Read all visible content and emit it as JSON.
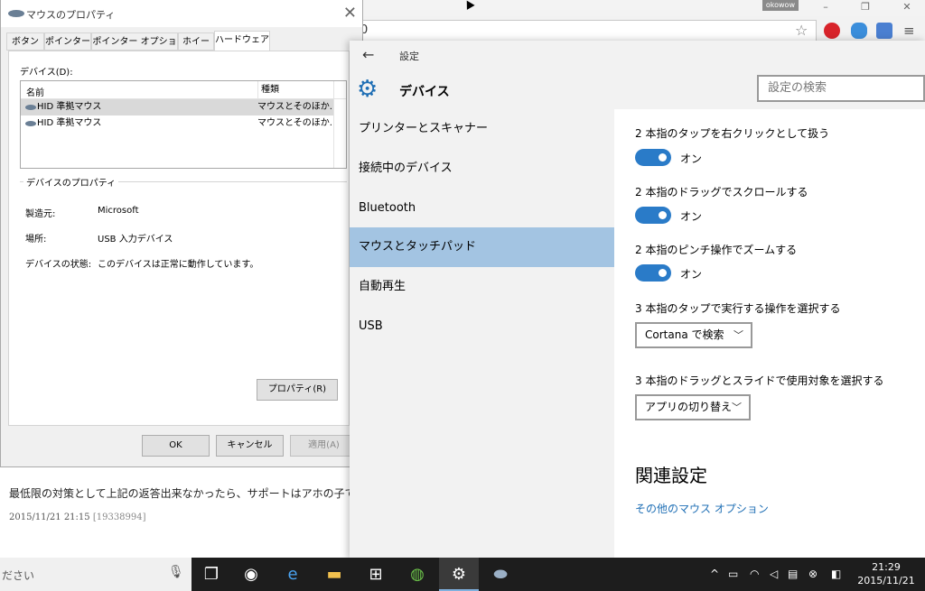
{
  "browser": {
    "user_chip": "okowow",
    "omnibox_text": "0"
  },
  "forum": {
    "body": "最低限の対策として上記の返答出来なかったら、サポートはアホの子ですね",
    "date": "2015/11/21 21:15",
    "post_id": "[19338994]"
  },
  "mouse_dialog": {
    "title": "マウスのプロパティ",
    "tabs": [
      "ボタン",
      "ポインター",
      "ポインター オプション",
      "ホイール",
      "ハードウェア"
    ],
    "active_tab": "ハードウェア",
    "devices_label": "デバイス(D):",
    "columns": [
      "名前",
      "種類"
    ],
    "devices": [
      {
        "name": "HID 準拠マウス",
        "kind": "マウスとそのほか..."
      },
      {
        "name": "HID 準拠マウス",
        "kind": "マウスとそのほか..."
      }
    ],
    "properties_legend": "デバイスのプロパティ",
    "properties": [
      {
        "key": "製造元:",
        "value": "Microsoft"
      },
      {
        "key": "場所:",
        "value": "USB 入力デバイス"
      },
      {
        "key": "デバイスの状態:",
        "value": "このデバイスは正常に動作しています。"
      }
    ],
    "properties_button": "プロパティ(R)",
    "ok": "OK",
    "cancel": "キャンセル",
    "apply": "適用(A)"
  },
  "settings": {
    "app_title": "設定",
    "heading": "デバイス",
    "search_placeholder": "設定の検索",
    "nav": [
      "プリンターとスキャナー",
      "接続中のデバイス",
      "Bluetooth",
      "マウスとタッチパッド",
      "自動再生",
      "USB"
    ],
    "active_nav": "マウスとタッチパッド",
    "toggles": [
      {
        "label": "2 本指のタップを右クリックとして扱う",
        "state": "オン"
      },
      {
        "label": "2 本指のドラッグでスクロールする",
        "state": "オン"
      },
      {
        "label": "2 本指のピンチ操作でズームする",
        "state": "オン"
      }
    ],
    "three_finger_tap_label": "3 本指のタップで実行する操作を選択する",
    "three_finger_tap_value": "Cortana で検索",
    "three_finger_drag_label": "3 本指のドラッグとスライドで使用対象を選択する",
    "three_finger_drag_value": "アプリの切り替え",
    "related_title": "関連設定",
    "related_link": "その他のマウス オプション"
  },
  "taskbar": {
    "search_placeholder": "ださい",
    "time": "21:29",
    "date": "2015/11/21"
  },
  "colors": {
    "accent": "#2a7bc8",
    "nav_selected": "#a3c4e2",
    "link": "#1f6fb5"
  }
}
